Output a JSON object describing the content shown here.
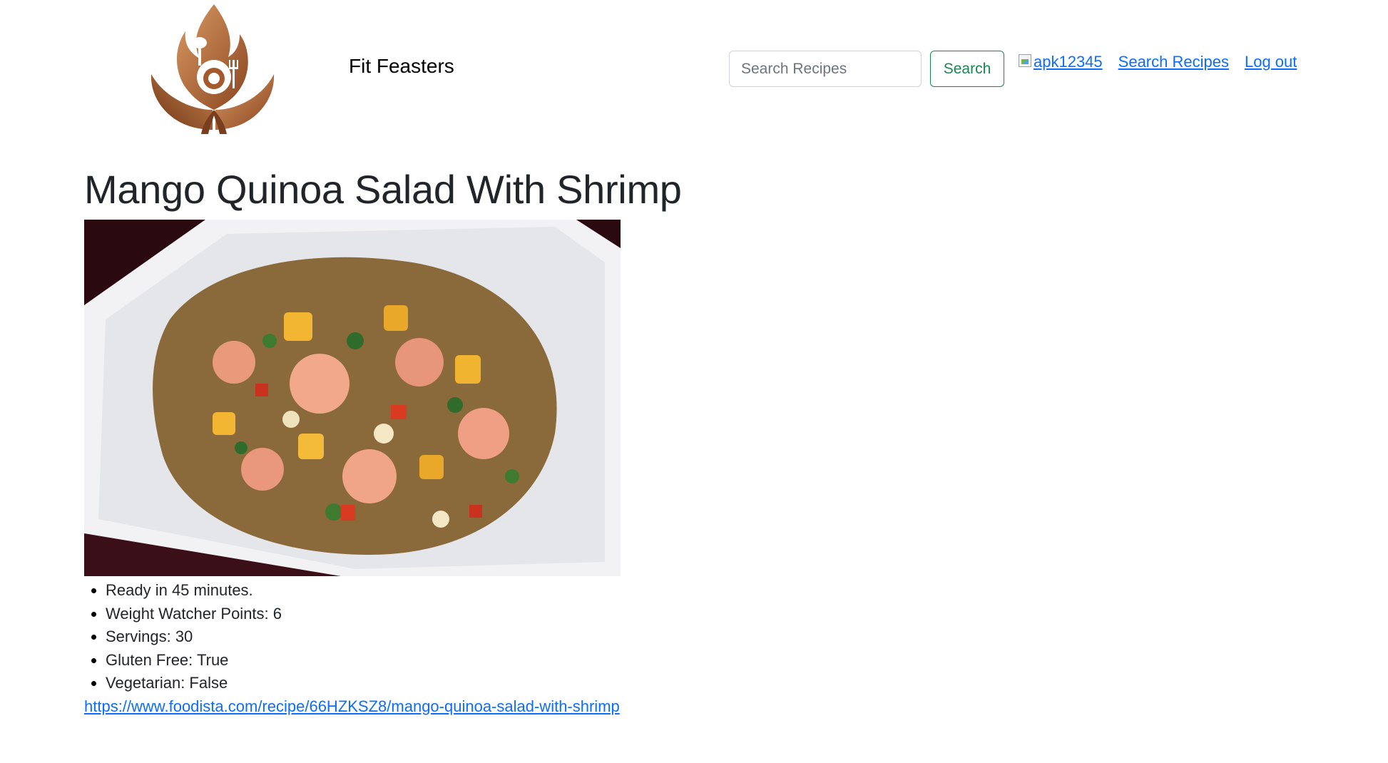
{
  "header": {
    "brand": "Fit Feasters",
    "logo_icon": "flame-leaf-chef-logo",
    "search": {
      "placeholder": "Search Recipes",
      "value": ""
    },
    "search_button": "Search",
    "avatar_alt": "apk12345",
    "nav": {
      "search_recipes": "Search Recipes",
      "log_out": "Log out"
    }
  },
  "recipe": {
    "title": "Mango Quinoa Salad With Shrimp",
    "image_alt": "Mango Quinoa Salad With Shrimp",
    "details": [
      "Ready in 45 minutes.",
      "Weight Watcher Points: 6",
      "Servings: 30",
      "Gluten Free: True",
      "Vegetarian: False"
    ],
    "source_url": "https://www.foodista.com/recipe/66HZKSZ8/mango-quinoa-salad-with-shrimp"
  },
  "colors": {
    "link": "#0d6efd",
    "search_button": "#198754",
    "logo_brown": "#b0673a",
    "logo_dark": "#7a3e1e"
  }
}
